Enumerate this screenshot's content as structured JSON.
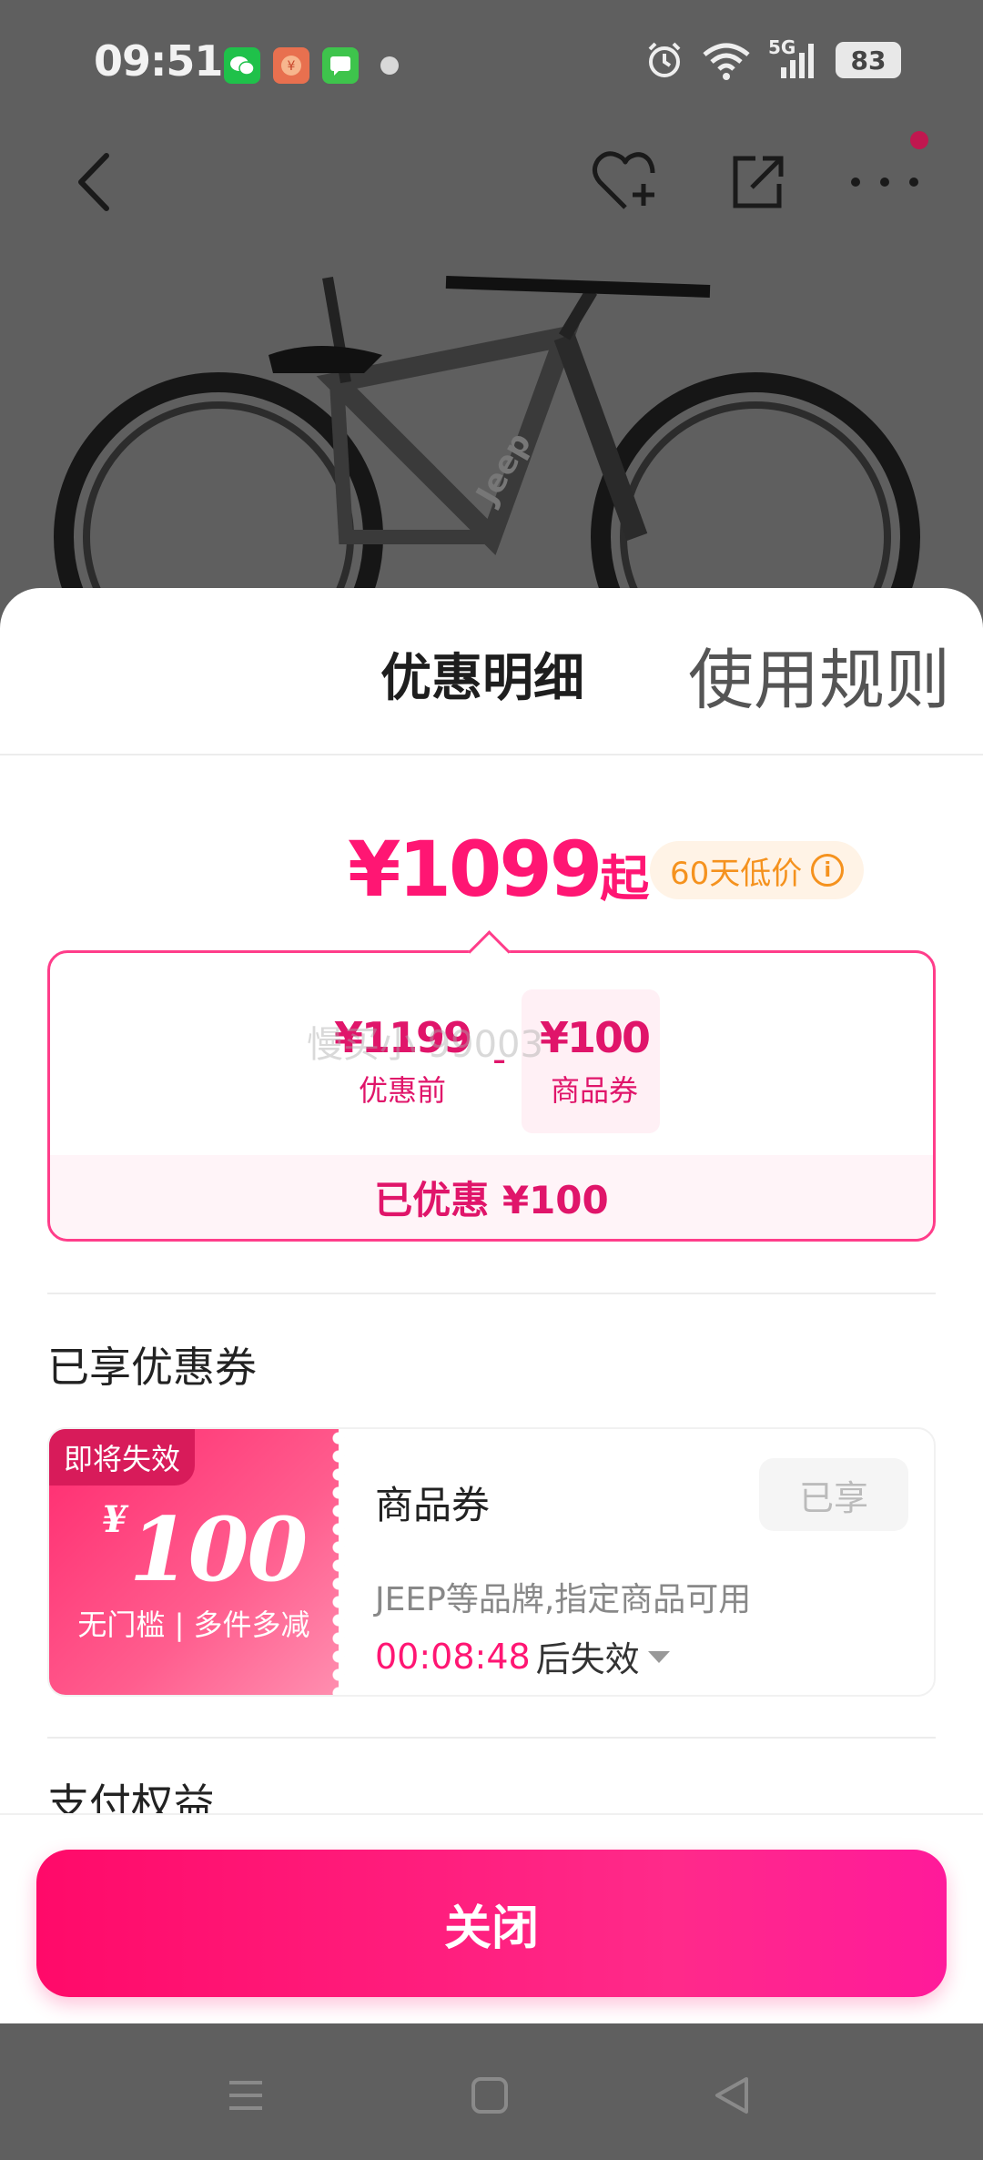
{
  "status_bar": {
    "time": "09:51",
    "network": "5G",
    "battery": "83"
  },
  "nav": {
    "back": "back",
    "favorite": "favorite",
    "share": "share",
    "more": "more"
  },
  "sheet": {
    "tab_active": "优惠明细",
    "tab_other": "使用规则",
    "price_main": "¥1099",
    "price_suffix": "起",
    "low_badge": "60天低价",
    "calc": {
      "before_value": "¥1199",
      "before_label": "优惠前",
      "minus": "-",
      "coupon_value": "¥100",
      "coupon_label": "商品券",
      "watermark": "慢买小 99003",
      "saved": "已优惠 ¥100"
    },
    "section_title": "已享优惠券",
    "coupon": {
      "expire_tag": "即将失效",
      "currency": "¥",
      "amount": "100",
      "condition": "无门槛 | 多件多减",
      "name": "商品券",
      "status": "已享",
      "desc": "JEEP等品牌,指定商品可用",
      "countdown": "00:08:48",
      "countdown_suffix": "后失效"
    },
    "next_section": "支付权益",
    "close_button": "关闭"
  },
  "colors": {
    "accent": "#ff1673",
    "badge_orange": "#f5921e",
    "overlay": "#5f5f5f"
  }
}
